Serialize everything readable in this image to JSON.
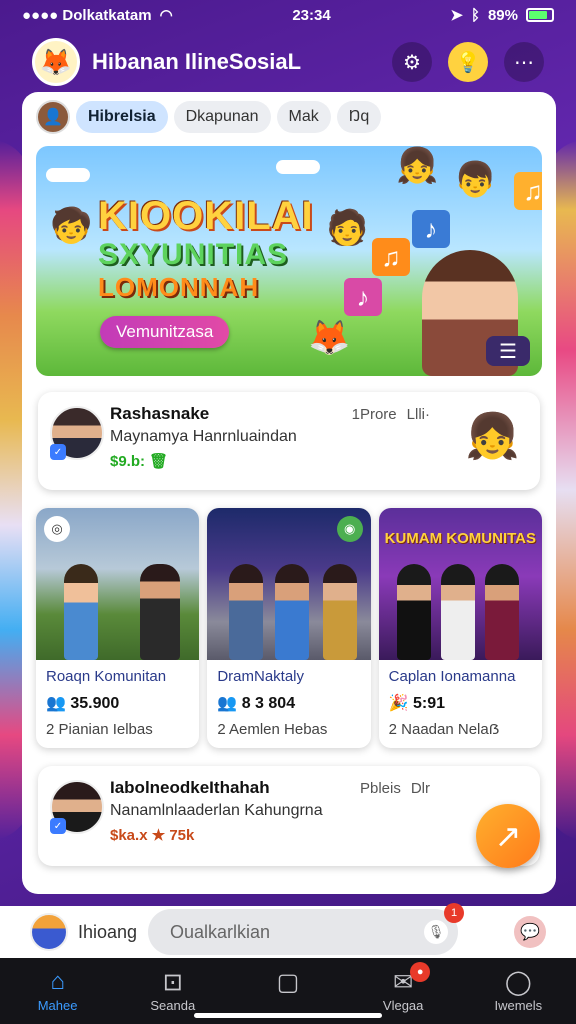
{
  "status_bar": {
    "carrier": "●●●● Dolkatkatam",
    "time": "23:34",
    "battery": "89%"
  },
  "header": {
    "title": "Hibanan IlineSosiaL"
  },
  "chips": [
    "Hibrelsia",
    "Dkapunan",
    "Mak",
    "Ŋq"
  ],
  "banner": {
    "line1": "KIOOKILAI",
    "line2": "SXYUNITIAS",
    "line3": "LOMONNAH",
    "cta": "Vemunitzasa"
  },
  "post1": {
    "name": "Rashasnake",
    "subtitle": "Maynamya Hanrnluaindan",
    "meta": "$9.b: 🗑",
    "right1": "1Prore",
    "right2": "Llli·"
  },
  "grid": [
    {
      "title": "Roaqn Komunitan",
      "stats": "35.900",
      "sub": "2 Pianian Ielbas"
    },
    {
      "title": "DramNaktaly",
      "stats": "8 3 804",
      "sub": "2 Aemlen Hebas"
    },
    {
      "title": "Caplan Ionamanna",
      "stats": "5:91",
      "sub": "2 Naadan Nelaẞ",
      "image_label": "KUMAM KOMUNITAS"
    }
  ],
  "post2": {
    "name": "IabolneodkeIthahah",
    "subtitle": "Nanamlnlaaderlan Kahungrna",
    "meta": "$ka.x ★ 75k",
    "right1": "Pbleis",
    "right2": "Dlr"
  },
  "composer": {
    "label": "Ihioang",
    "placeholder": "Oualkarlkian"
  },
  "bottom_nav": [
    {
      "label": "Mahee",
      "icon": "home-icon"
    },
    {
      "label": "Seanda",
      "icon": "search-icon"
    },
    {
      "label": "",
      "icon": "plus-icon"
    },
    {
      "label": "Vlegaa",
      "icon": "message-icon"
    },
    {
      "label": "Iwemels",
      "icon": "profile-icon"
    }
  ],
  "colors": {
    "accent": "#3b9bff",
    "background": "#4b1a8e",
    "fab": "#ff8c1a"
  }
}
